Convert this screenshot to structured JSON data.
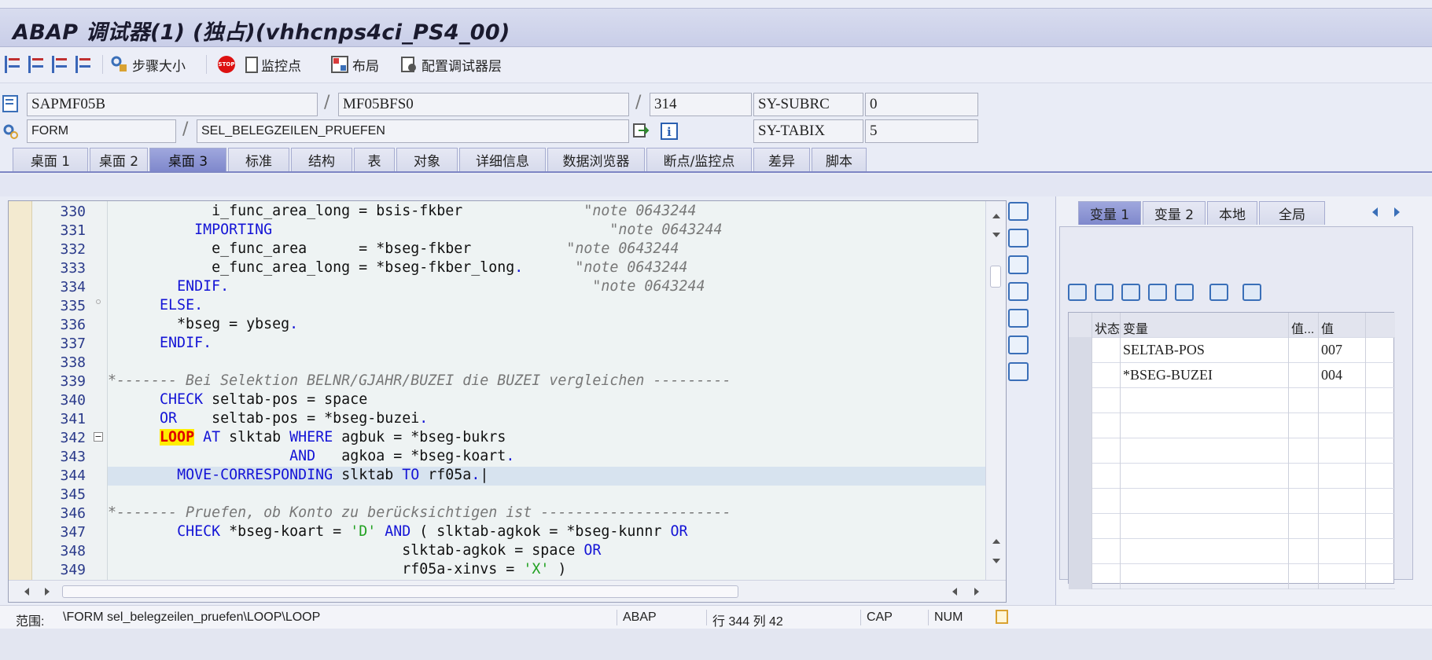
{
  "window": {
    "title": "ABAP 调试器(1) (独占)(vhhcnps4ci_PS4_00)"
  },
  "toolbar": {
    "step_size": "步骤大小",
    "watchpoint": "监控点",
    "layout": "布局",
    "configure": "配置调试器层"
  },
  "context": {
    "program": "SAPMF05B",
    "include": "MF05BFS0",
    "line": "314",
    "sy_subrc_label": "SY-SUBRC",
    "sy_subrc_value": "0",
    "event_type": "FORM",
    "event_name": "SEL_BELEGZEILEN_PRUEFEN",
    "sy_tabix_label": "SY-TABIX",
    "sy_tabix_value": "5"
  },
  "tabs": [
    "桌面 1",
    "桌面 2",
    "桌面 3",
    "标准",
    "结构",
    "表",
    "对象",
    "详细信息",
    "数据浏览器",
    "断点/监控点",
    "差异",
    "脚本"
  ],
  "active_tab": "桌面 3",
  "editor": {
    "lines": [
      {
        "n": "330",
        "html": "            i_func_area_long = bsis-fkber              <span class='cm'>\"note 0643244</span>"
      },
      {
        "n": "331",
        "html": "          <span class='kw'>IMPORTING</span>                                       <span class='cm'>\"note 0643244</span>"
      },
      {
        "n": "332",
        "html": "            e_func_area      = *bseg-fkber           <span class='cm'>\"note 0643244</span>"
      },
      {
        "n": "333",
        "html": "            e_func_area_long = *bseg-fkber_long<span class='kw'>.</span>      <span class='cm'>\"note 0643244</span>"
      },
      {
        "n": "334",
        "html": "        <span class='kw'>ENDIF.</span>                                          <span class='cm'>\"note 0643244</span>"
      },
      {
        "n": "335",
        "html": "      <span class='kw'>ELSE.</span>"
      },
      {
        "n": "336",
        "html": "        *bseg = ybseg<span class='kw'>.</span>"
      },
      {
        "n": "337",
        "html": "      <span class='kw'>ENDIF.</span>"
      },
      {
        "n": "338",
        "html": ""
      },
      {
        "n": "339",
        "html": "<span class='cm'>*------- Bei Selektion BELNR/GJAHR/BUZEI die BUZEI vergleichen ---------</span>"
      },
      {
        "n": "340",
        "html": "      <span class='kw'>CHECK</span> seltab-pos = space"
      },
      {
        "n": "341",
        "html": "      <span class='kw'>OR</span>    seltab-pos = *bseg-buzei<span class='kw'>.</span>"
      },
      {
        "n": "342",
        "html": "      <span class='hl'>LOOP</span> <span class='kw'>AT</span> slktab <span class='kw'>WHERE</span> agbuk = *bseg-bukrs"
      },
      {
        "n": "343",
        "html": "                     <span class='kw'>AND</span>   agkoa = *bseg-koart<span class='kw'>.</span>"
      },
      {
        "n": "344",
        "html": "        <span class='kw'>MOVE-CORRESPONDING</span> slktab <span class='kw'>TO</span> rf05a<span class='kw'>.</span>|"
      },
      {
        "n": "345",
        "html": ""
      },
      {
        "n": "346",
        "html": "<span class='cm'>*------- Pruefen, ob Konto zu berücksichtigen ist ----------------------</span>"
      },
      {
        "n": "347",
        "html": "        <span class='kw'>CHECK</span> *bseg-koart = <span class='st'>'D'</span> <span class='kw'>AND</span> ( slktab-agkok = *bseg-kunnr <span class='kw'>OR</span>"
      },
      {
        "n": "348",
        "html": "                                  slktab-agkok = space <span class='kw'>OR</span>"
      },
      {
        "n": "349",
        "html": "                                  rf05a-xinvs = <span class='st'>'X'</span> )"
      }
    ]
  },
  "variables": {
    "tabs": [
      "变量 1",
      "变量 2",
      "本地",
      "全局"
    ],
    "columns": [
      "状态",
      "变量",
      "值...",
      "值"
    ],
    "rows": [
      {
        "name": "SELTAB-POS",
        "value": "007"
      },
      {
        "name": "*BSEG-BUZEI",
        "value": "004"
      }
    ]
  },
  "statusbar": {
    "scope_label": "范围:",
    "scope_value": "\\FORM sel_belegzeilen_pruefen\\LOOP\\LOOP",
    "language": "ABAP",
    "position": "行 344 列  42",
    "caps": "CAP",
    "num": "NUM"
  }
}
